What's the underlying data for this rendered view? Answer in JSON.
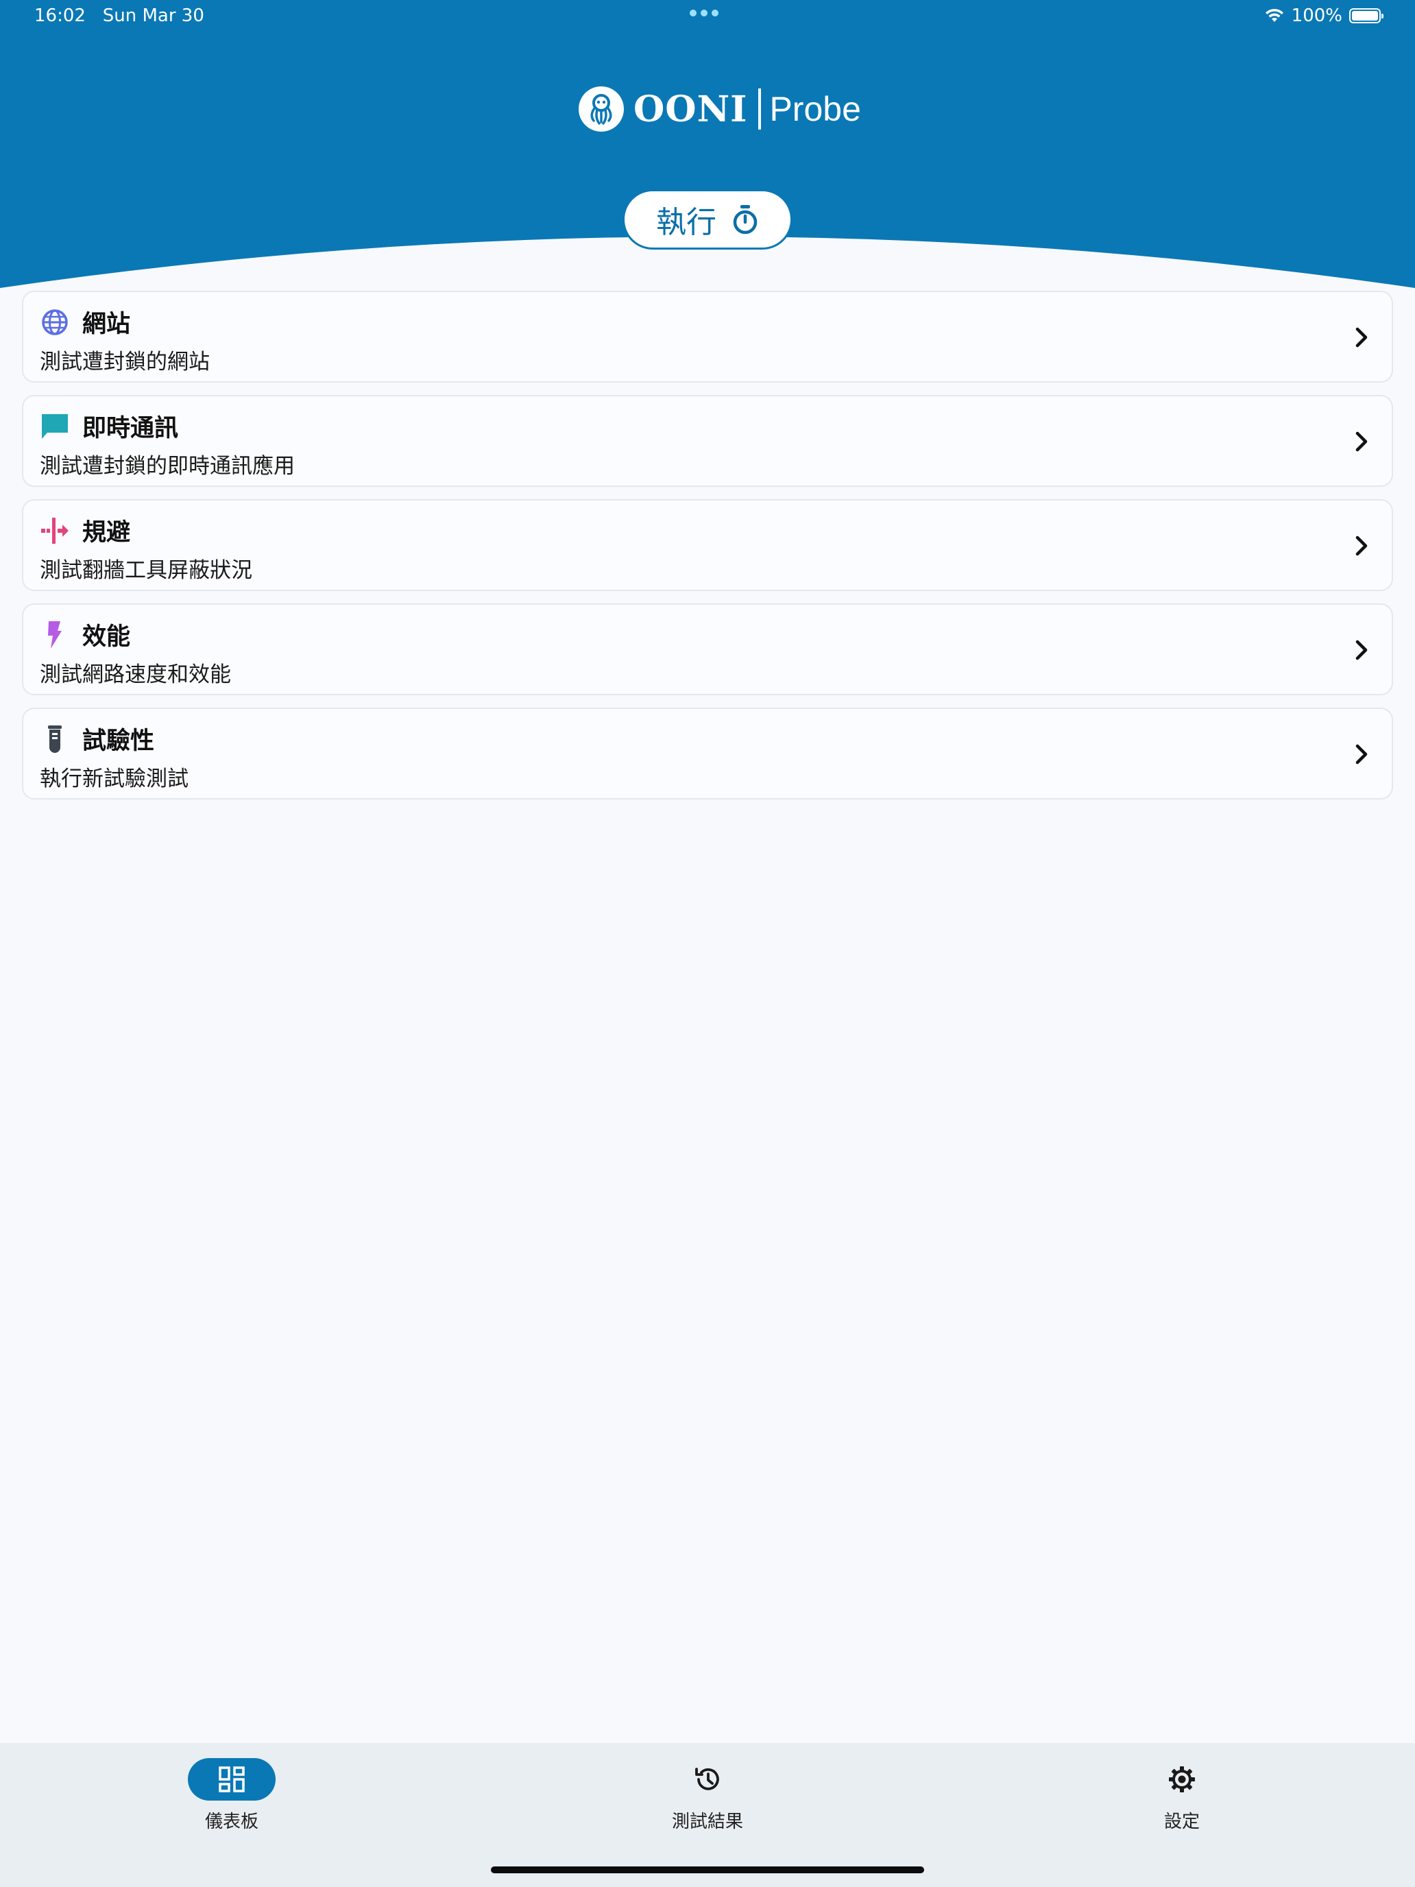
{
  "status_bar": {
    "time": "16:02",
    "date": "Sun Mar 30",
    "battery": "100%"
  },
  "header": {
    "logo_name": "OONI",
    "logo_product": "Probe",
    "run_label": "執行",
    "background_color": "#0a78b5"
  },
  "cards": [
    {
      "title": "網站",
      "description": "測試遭封鎖的網站",
      "icon": "globe-icon",
      "color": "#5b6ee1"
    },
    {
      "title": "即時通訊",
      "description": "測試遭封鎖的即時通訊應用",
      "icon": "chat-icon",
      "color": "#1fa7b5"
    },
    {
      "title": "規避",
      "description": "測試翻牆工具屏蔽狀況",
      "icon": "circumvention-icon",
      "color": "#e0467a"
    },
    {
      "title": "效能",
      "description": "測試網路速度和效能",
      "icon": "lightning-icon",
      "color": "#b65be3"
    },
    {
      "title": "試驗性",
      "description": "執行新試驗測試",
      "icon": "test-tube-icon",
      "color": "#3d4550"
    }
  ],
  "nav": {
    "dashboard": "儀表板",
    "results": "測試結果",
    "settings": "設定",
    "active": "dashboard"
  }
}
